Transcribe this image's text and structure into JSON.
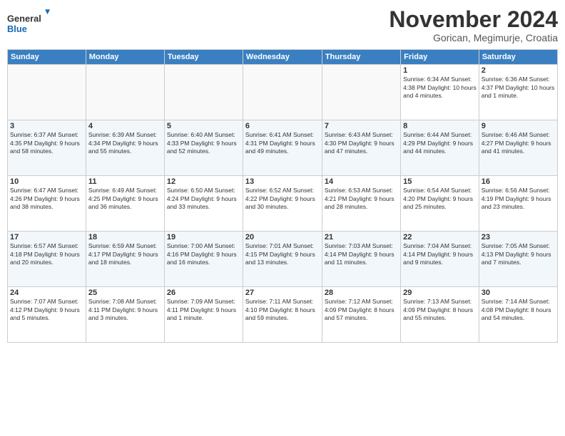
{
  "header": {
    "logo_general": "General",
    "logo_blue": "Blue",
    "month_title": "November 2024",
    "subtitle": "Gorican, Megimurje, Croatia"
  },
  "weekdays": [
    "Sunday",
    "Monday",
    "Tuesday",
    "Wednesday",
    "Thursday",
    "Friday",
    "Saturday"
  ],
  "weeks": [
    [
      {
        "day": "",
        "info": ""
      },
      {
        "day": "",
        "info": ""
      },
      {
        "day": "",
        "info": ""
      },
      {
        "day": "",
        "info": ""
      },
      {
        "day": "",
        "info": ""
      },
      {
        "day": "1",
        "info": "Sunrise: 6:34 AM\nSunset: 4:38 PM\nDaylight: 10 hours\nand 4 minutes."
      },
      {
        "day": "2",
        "info": "Sunrise: 6:36 AM\nSunset: 4:37 PM\nDaylight: 10 hours\nand 1 minute."
      }
    ],
    [
      {
        "day": "3",
        "info": "Sunrise: 6:37 AM\nSunset: 4:35 PM\nDaylight: 9 hours\nand 58 minutes."
      },
      {
        "day": "4",
        "info": "Sunrise: 6:39 AM\nSunset: 4:34 PM\nDaylight: 9 hours\nand 55 minutes."
      },
      {
        "day": "5",
        "info": "Sunrise: 6:40 AM\nSunset: 4:33 PM\nDaylight: 9 hours\nand 52 minutes."
      },
      {
        "day": "6",
        "info": "Sunrise: 6:41 AM\nSunset: 4:31 PM\nDaylight: 9 hours\nand 49 minutes."
      },
      {
        "day": "7",
        "info": "Sunrise: 6:43 AM\nSunset: 4:30 PM\nDaylight: 9 hours\nand 47 minutes."
      },
      {
        "day": "8",
        "info": "Sunrise: 6:44 AM\nSunset: 4:29 PM\nDaylight: 9 hours\nand 44 minutes."
      },
      {
        "day": "9",
        "info": "Sunrise: 6:46 AM\nSunset: 4:27 PM\nDaylight: 9 hours\nand 41 minutes."
      }
    ],
    [
      {
        "day": "10",
        "info": "Sunrise: 6:47 AM\nSunset: 4:26 PM\nDaylight: 9 hours\nand 38 minutes."
      },
      {
        "day": "11",
        "info": "Sunrise: 6:49 AM\nSunset: 4:25 PM\nDaylight: 9 hours\nand 36 minutes."
      },
      {
        "day": "12",
        "info": "Sunrise: 6:50 AM\nSunset: 4:24 PM\nDaylight: 9 hours\nand 33 minutes."
      },
      {
        "day": "13",
        "info": "Sunrise: 6:52 AM\nSunset: 4:22 PM\nDaylight: 9 hours\nand 30 minutes."
      },
      {
        "day": "14",
        "info": "Sunrise: 6:53 AM\nSunset: 4:21 PM\nDaylight: 9 hours\nand 28 minutes."
      },
      {
        "day": "15",
        "info": "Sunrise: 6:54 AM\nSunset: 4:20 PM\nDaylight: 9 hours\nand 25 minutes."
      },
      {
        "day": "16",
        "info": "Sunrise: 6:56 AM\nSunset: 4:19 PM\nDaylight: 9 hours\nand 23 minutes."
      }
    ],
    [
      {
        "day": "17",
        "info": "Sunrise: 6:57 AM\nSunset: 4:18 PM\nDaylight: 9 hours\nand 20 minutes."
      },
      {
        "day": "18",
        "info": "Sunrise: 6:59 AM\nSunset: 4:17 PM\nDaylight: 9 hours\nand 18 minutes."
      },
      {
        "day": "19",
        "info": "Sunrise: 7:00 AM\nSunset: 4:16 PM\nDaylight: 9 hours\nand 16 minutes."
      },
      {
        "day": "20",
        "info": "Sunrise: 7:01 AM\nSunset: 4:15 PM\nDaylight: 9 hours\nand 13 minutes."
      },
      {
        "day": "21",
        "info": "Sunrise: 7:03 AM\nSunset: 4:14 PM\nDaylight: 9 hours\nand 11 minutes."
      },
      {
        "day": "22",
        "info": "Sunrise: 7:04 AM\nSunset: 4:14 PM\nDaylight: 9 hours\nand 9 minutes."
      },
      {
        "day": "23",
        "info": "Sunrise: 7:05 AM\nSunset: 4:13 PM\nDaylight: 9 hours\nand 7 minutes."
      }
    ],
    [
      {
        "day": "24",
        "info": "Sunrise: 7:07 AM\nSunset: 4:12 PM\nDaylight: 9 hours\nand 5 minutes."
      },
      {
        "day": "25",
        "info": "Sunrise: 7:08 AM\nSunset: 4:11 PM\nDaylight: 9 hours\nand 3 minutes."
      },
      {
        "day": "26",
        "info": "Sunrise: 7:09 AM\nSunset: 4:11 PM\nDaylight: 9 hours\nand 1 minute."
      },
      {
        "day": "27",
        "info": "Sunrise: 7:11 AM\nSunset: 4:10 PM\nDaylight: 8 hours\nand 59 minutes."
      },
      {
        "day": "28",
        "info": "Sunrise: 7:12 AM\nSunset: 4:09 PM\nDaylight: 8 hours\nand 57 minutes."
      },
      {
        "day": "29",
        "info": "Sunrise: 7:13 AM\nSunset: 4:09 PM\nDaylight: 8 hours\nand 55 minutes."
      },
      {
        "day": "30",
        "info": "Sunrise: 7:14 AM\nSunset: 4:08 PM\nDaylight: 8 hours\nand 54 minutes."
      }
    ]
  ]
}
